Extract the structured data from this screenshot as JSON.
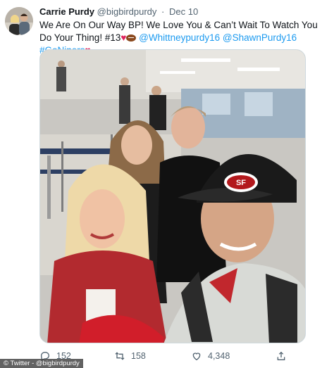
{
  "author": {
    "display_name": "Carrie Purdy",
    "handle": "@bigbirdpurdy",
    "separator": "·",
    "date": "Dec 10"
  },
  "tweet": {
    "text_part1": "We Are On Our Way BP! We Love You & Can’t Wait To Watch You Do Your Thing! #13",
    "mention1": "@Whittneypurdy16",
    "mention2": "@ShawnPurdy16",
    "hashtag": "#GoNiners"
  },
  "icons": {
    "reply": "reply-icon",
    "retweet": "retweet-icon",
    "like": "heart-icon",
    "share": "share-icon",
    "heart_emoji": "red-heart-emoji",
    "football_emoji": "football-emoji"
  },
  "actions": {
    "reply_count": "152",
    "retweet_count": "158",
    "like_count": "4,348"
  },
  "credit": "© Twitter - @bigbirdpurdy",
  "colors": {
    "link": "#1d9bf0",
    "text": "#0f1419",
    "muted": "#536471"
  }
}
